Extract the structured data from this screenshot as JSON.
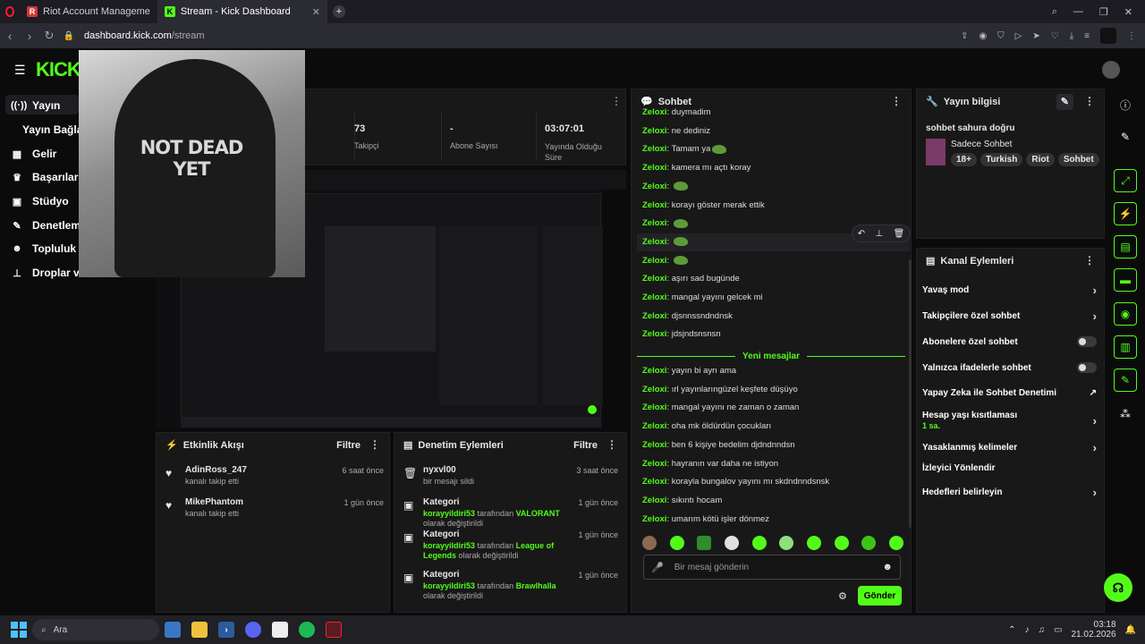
{
  "browser": {
    "tabs": [
      {
        "title": "Riot Account Manageme"
      },
      {
        "title": "Stream - Kick Dashboard"
      }
    ],
    "url_host": "dashboard.kick.com",
    "url_path": "/stream"
  },
  "logo": "KICK",
  "nav": [
    {
      "label": "Yayın",
      "icon": "broadcast-icon"
    },
    {
      "label": "Yayın Bağlan",
      "icon": ""
    },
    {
      "label": "Gelir",
      "icon": "revenue-icon"
    },
    {
      "label": "Başarılar",
      "icon": "trophy-icon"
    },
    {
      "label": "Stüdyo",
      "icon": "studio-icon"
    },
    {
      "label": "Denetleme",
      "icon": "wrench-icon"
    },
    {
      "label": "Topluluk",
      "icon": "people-icon"
    },
    {
      "label": "Droplar ve",
      "icon": "drops-icon"
    }
  ],
  "stats": [
    {
      "value": "73",
      "label": "Takipçi"
    },
    {
      "value": "-",
      "label": "Abone Sayısı"
    },
    {
      "value": "03:07:01",
      "label": "Yayında Olduğu Süre"
    }
  ],
  "overlay": {
    "hoodie_text": "NOT DEAD YET"
  },
  "activity": {
    "title": "Etkinlik Akışı",
    "filter": "Filtre",
    "items": [
      {
        "user": "AdinRoss_247",
        "desc": "kanalı takip etti",
        "time": "6 saat önce"
      },
      {
        "user": "MikePhantom",
        "desc": "kanalı takip etti",
        "time": "1 gün önce"
      }
    ]
  },
  "moderation": {
    "title": "Denetim Eylemleri",
    "filter": "Filtre",
    "items": [
      {
        "title": "nyxvl00",
        "desc_user": "",
        "desc": "bir mesajı sildi",
        "desc_value": "",
        "desc_end": "",
        "time": "3 saat önce"
      },
      {
        "title": "Kategori",
        "desc_user": "korayyildiri53",
        "desc": " tarafından ",
        "desc_value": "VALORANT",
        "desc_end": " olarak değiştirildi",
        "time": "1 gün önce"
      },
      {
        "title": "Kategori",
        "desc_user": "korayyildiri53",
        "desc": " tarafından ",
        "desc_value": "League of Legends",
        "desc_end": " olarak değiştirildi",
        "time": "1 gün önce"
      },
      {
        "title": "Kategori",
        "desc_user": "korayyildiri53",
        "desc": " tarafından ",
        "desc_value": "Brawlhalla",
        "desc_end": " olarak değiştirildi",
        "time": "1 gün önce"
      }
    ]
  },
  "chat": {
    "title": "Sohbet",
    "messages": [
      {
        "user": "Zeloxi",
        "text": "duymadim",
        "emote": false
      },
      {
        "user": "Zeloxi",
        "text": "ne dediniz",
        "emote": false
      },
      {
        "user": "Zeloxi",
        "text": "Tamam ya",
        "emote": true
      },
      {
        "user": "Zeloxi",
        "text": "kamera mı açtı koray",
        "emote": false
      },
      {
        "user": "Zeloxi",
        "text": "",
        "emote": true
      },
      {
        "user": "Zeloxi",
        "text": "korayı göster merak ettik",
        "emote": false
      },
      {
        "user": "Zeloxi",
        "text": "",
        "emote": true
      },
      {
        "user": "Zeloxi",
        "text": "",
        "emote": true
      },
      {
        "user": "Zeloxi",
        "text": "",
        "emote": true
      },
      {
        "user": "Zeloxi",
        "text": "aşırı sad bugünde",
        "emote": false
      },
      {
        "user": "Zeloxi",
        "text": "mangal yayını gelcek mi",
        "emote": false
      },
      {
        "user": "Zeloxi",
        "text": "djsnnssndndnsk",
        "emote": false
      },
      {
        "user": "Zeloxi",
        "text": "jdsjndsnsnsn",
        "emote": false
      }
    ],
    "new_messages_label": "Yeni mesajlar",
    "new_messages": [
      {
        "user": "Zeloxi",
        "text": "yayın bi ayrı ama"
      },
      {
        "user": "Zeloxi",
        "text": "ırl yayınlarıngüzel keşfete düşüyo"
      },
      {
        "user": "Zeloxi",
        "text": "mangal yayını ne zaman o zaman"
      },
      {
        "user": "Zeloxi",
        "text": "oha mk öldürdün çocukları"
      },
      {
        "user": "Zeloxi",
        "text": "ben 6 kişiye bedelim djdndnndsn"
      },
      {
        "user": "Zeloxi",
        "text": "hayranın var daha ne istiyon"
      },
      {
        "user": "Zeloxi",
        "text": "korayla bungalov yayını mı skdndnndsnsk"
      },
      {
        "user": "Zeloxi",
        "text": "sıkıntı hocam"
      },
      {
        "user": "Zeloxi",
        "text": "umarım kötü işler dönmez"
      }
    ],
    "input_placeholder": "Bir mesaj gönderin",
    "send_label": "Gönder"
  },
  "stream_info": {
    "title": "Yayın bilgisi",
    "stream_title": "sohbet sahura doğru",
    "category": "Sadece Sohbet",
    "tags": [
      "18+",
      "Turkish",
      "Riot",
      "Sohbet"
    ]
  },
  "channel_actions": {
    "title": "Kanal Eylemleri",
    "items": [
      {
        "label": "Yavaş mod",
        "control": "chevron",
        "sub": ""
      },
      {
        "label": "Takipçilere özel sohbet",
        "control": "chevron",
        "sub": ""
      },
      {
        "label": "Abonelere özel sohbet",
        "control": "toggle",
        "sub": ""
      },
      {
        "label": "Yalnızca ifadelerle sohbet",
        "control": "toggle",
        "sub": ""
      },
      {
        "label": "Yapay Zeka ile Sohbet Denetimi",
        "control": "external",
        "sub": ""
      },
      {
        "label": "Hesap yaşı kısıtlaması",
        "control": "chevron",
        "sub": "1 sa."
      },
      {
        "label": "Yasaklanmış kelimeler",
        "control": "chevron",
        "sub": ""
      },
      {
        "label": "İzleyici Yönlendir",
        "control": "none",
        "sub": ""
      },
      {
        "label": "Hedefleri belirleyin",
        "control": "chevron",
        "sub": ""
      }
    ]
  },
  "taskbar": {
    "search_placeholder": "Ara",
    "time": "03:18",
    "date": "21.02.2026"
  },
  "colors": {
    "accent": "#53fc18",
    "bg": "#0b0b0c",
    "panel": "#181819"
  }
}
